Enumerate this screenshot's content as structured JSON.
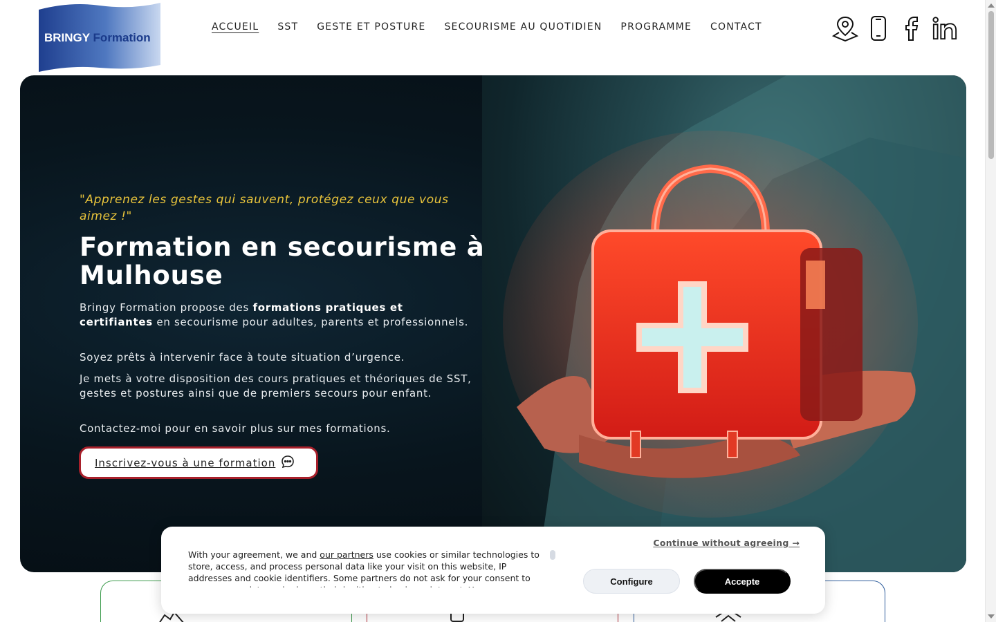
{
  "brand": {
    "logo_text_1": "BRINGY",
    "logo_text_2": "Formation"
  },
  "nav": {
    "items": [
      {
        "label": "ACCUEIL"
      },
      {
        "label": "SST"
      },
      {
        "label": "GESTE ET POSTURE"
      },
      {
        "label": "SECOURISME AU QUOTIDIEN"
      },
      {
        "label": "PROGRAMME"
      },
      {
        "label": "CONTACT"
      }
    ]
  },
  "social": {
    "icons": [
      "map-pin-icon",
      "mobile-phone-icon",
      "facebook-icon",
      "linkedin-icon"
    ]
  },
  "hero": {
    "quote": "\"Apprenez les gestes qui sauvent, protégez ceux que vous aimez !\"",
    "title": "Formation en secourisme à Mulhouse",
    "p1_before": "Bringy Formation propose des ",
    "p1_bold": "formations pratiques et certifiantes",
    "p1_after": " en secourisme pour adultes, parents et professionnels.",
    "p2": "Soyez prêts à intervenir face à toute situation d’urgence.",
    "p3": "Je mets à votre disposition des cours pratiques et théoriques de SST, gestes et postures ainsi que de premiers secours pour enfant.",
    "p4": "Contactez-moi pour en savoir plus sur mes formations.",
    "cta_label": "Inscrivez-vous à une formation"
  },
  "cookie": {
    "text_before": "With your agreement, we and ",
    "partners_link": "our partners",
    "text_after": " use cookies or similar technologies to store, access, and process personal data like your visit on this website, IP addresses and cookie identifiers. Some partners do not ask for your consent to process your data and rely on their legitimate business interest. You can",
    "continue_label": "Continue without agreeing →",
    "configure_label": "Configure",
    "accept_label": "Accepte"
  },
  "colors": {
    "accent_yellow": "#e9c43b",
    "cta_border": "#a8202b",
    "card_green": "#3a9a4a",
    "card_red": "#b02a35",
    "card_blue": "#2a5a9a"
  }
}
